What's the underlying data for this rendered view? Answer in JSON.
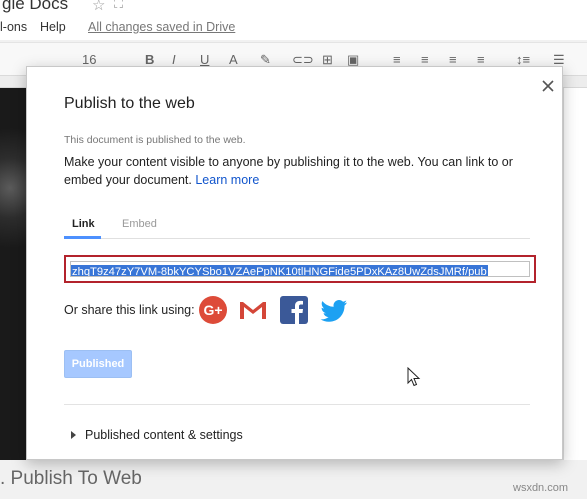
{
  "app": {
    "doc_title": "gle Docs",
    "menu_addons": "l-ons",
    "menu_help": "Help",
    "saved_status": "All changes saved in Drive",
    "font_size": "16"
  },
  "background": {
    "bottom_heading": ". Publish To Web",
    "watermark": "wsxdn.com"
  },
  "dialog": {
    "title": "Publish to the web",
    "published_note": "This document is published to the web.",
    "description": "Make your content visible to anyone by publishing it to the web. You can link to or embed your document.",
    "learn_more": "Learn more",
    "tabs": [
      {
        "label": "Link",
        "active": true
      },
      {
        "label": "Embed",
        "active": false
      }
    ],
    "link_url": "zhqT9z47zY7VM-8bkYCYSbo1VZAePpNK10tlHNGFide5PDxKAz8UwZdsJMRf/pub",
    "share_label": "Or share this link using:",
    "share_icons": [
      "google-plus-icon",
      "gmail-icon",
      "facebook-icon",
      "twitter-icon"
    ],
    "published_button": "Published",
    "settings_toggle": "Published content & settings"
  },
  "colors": {
    "accent_blue": "#4d90fe",
    "highlight": "#b3232c",
    "google_plus": "#dd4b39",
    "facebook": "#3b5998",
    "twitter": "#1da1f2"
  }
}
